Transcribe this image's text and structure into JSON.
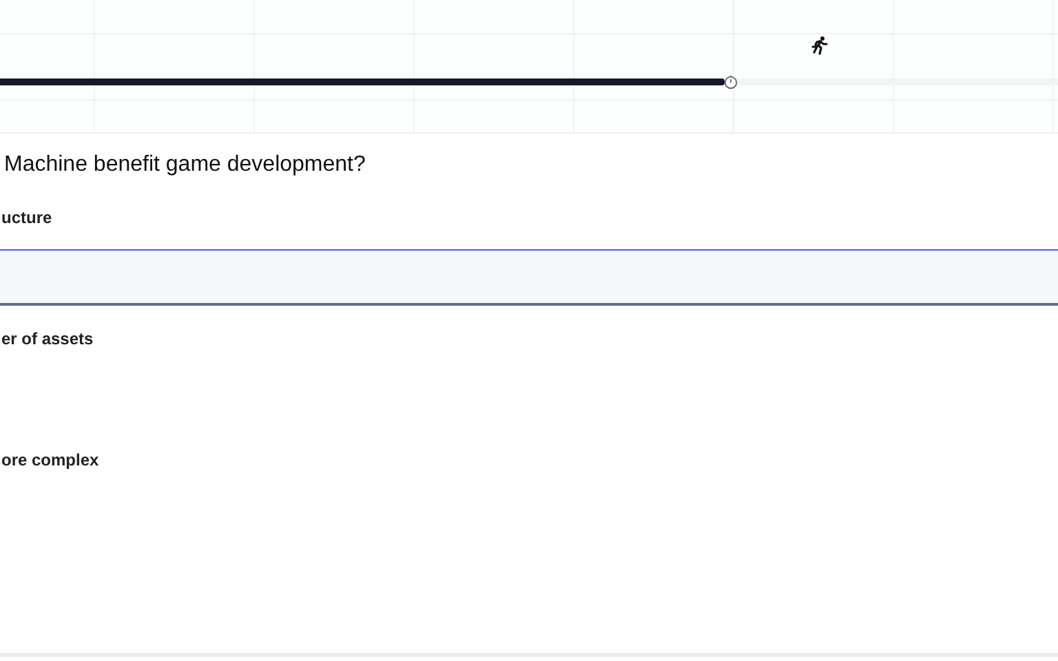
{
  "timer": {
    "level": 0.685
  },
  "question": "Machine benefit game development?",
  "options": [
    {
      "label": "ucture",
      "selected": true
    },
    {
      "label": "er of assets",
      "selected": false
    },
    {
      "label": "ore complex",
      "selected": false
    }
  ]
}
